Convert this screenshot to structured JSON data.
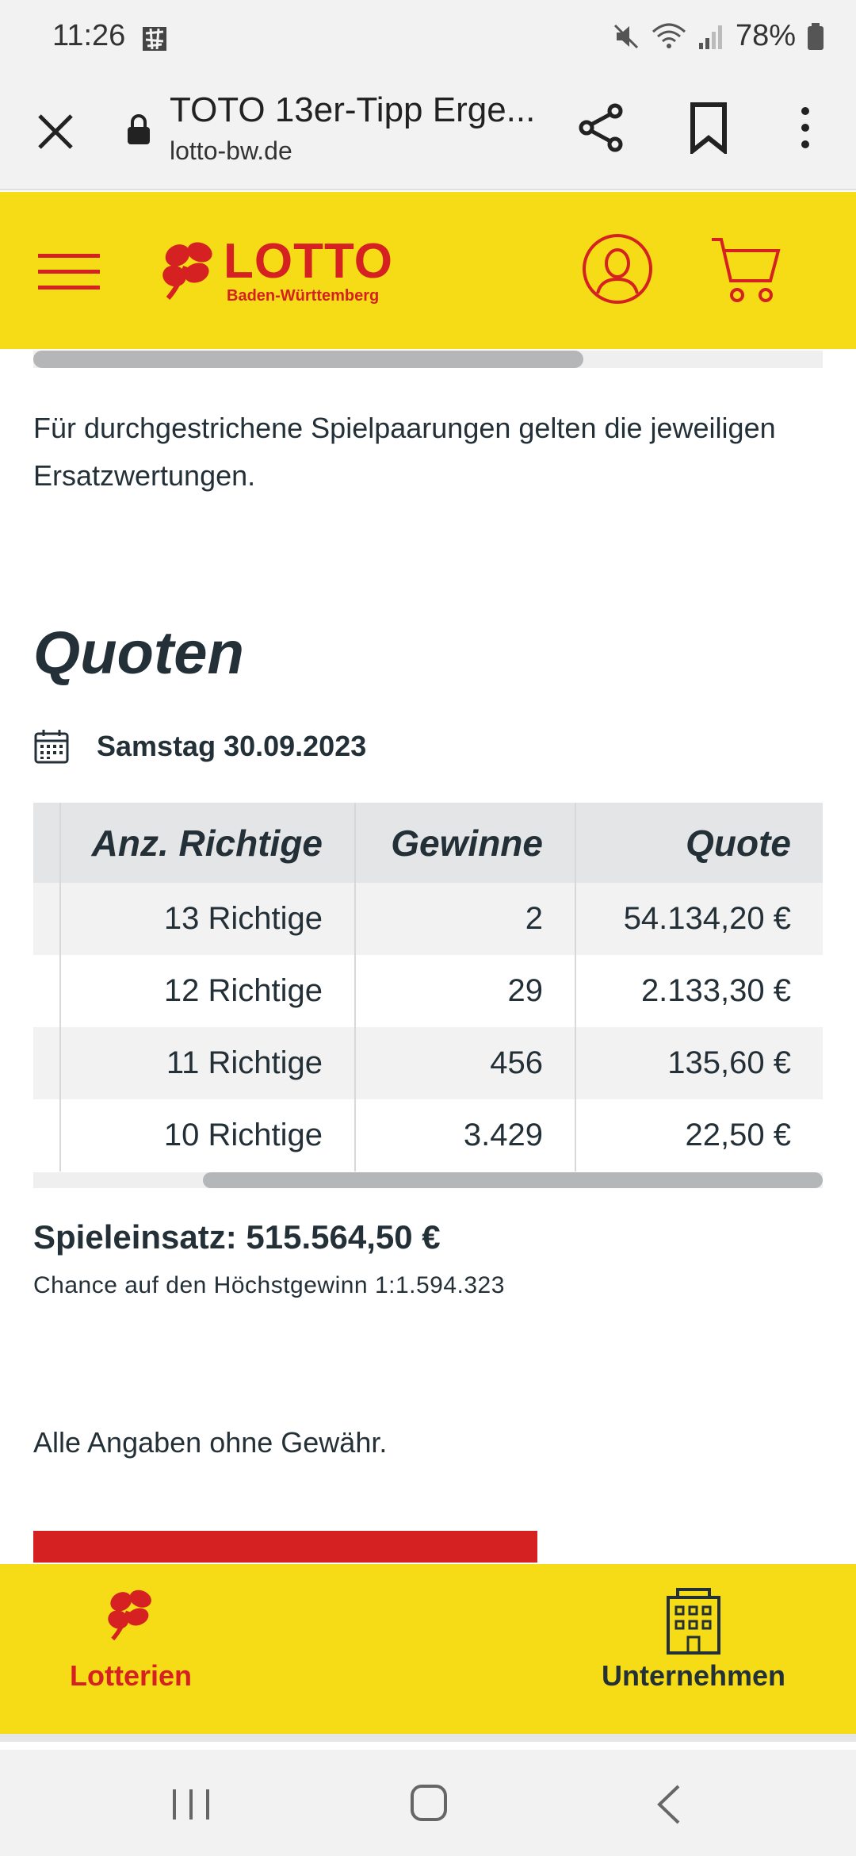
{
  "status_bar": {
    "time": "11:26",
    "battery": "78%"
  },
  "browser": {
    "title": "TOTO 13er-Tipp Erge...",
    "url": "lotto-bw.de"
  },
  "header": {
    "logo_word": "LOTTO",
    "logo_sub": "Baden-Württemberg"
  },
  "content": {
    "note": "Für durchgestrichene Spielpaarungen gelten die jeweiligen Ersatzwertungen.",
    "section_title": "Quoten",
    "date": "Samstag 30.09.2023",
    "table": {
      "headers": [
        "Anz. Richtige",
        "Gewinne",
        "Quote"
      ],
      "rows": [
        [
          "13 Richtige",
          "2",
          "54.134,20 €"
        ],
        [
          "12 Richtige",
          "29",
          "2.133,30 €"
        ],
        [
          "11 Richtige",
          "456",
          "135,60 €"
        ],
        [
          "10 Richtige",
          "3.429",
          "22,50 €"
        ]
      ]
    },
    "stake": "Spieleinsatz: 515.564,50 €",
    "chance": "Chance auf den Höchstgewinn 1:1.594.323",
    "disclaimer": "Alle Angaben ohne Gewähr."
  },
  "bottom_nav": {
    "items": [
      {
        "label": "Lotterien",
        "icon": "clover-icon",
        "color": "#d52121"
      },
      {
        "label": "Unternehmen",
        "icon": "building-icon",
        "color": "#243037"
      }
    ]
  },
  "colors": {
    "brand_yellow": "#f5dc16",
    "brand_red": "#d52121",
    "text_dark": "#243037"
  }
}
